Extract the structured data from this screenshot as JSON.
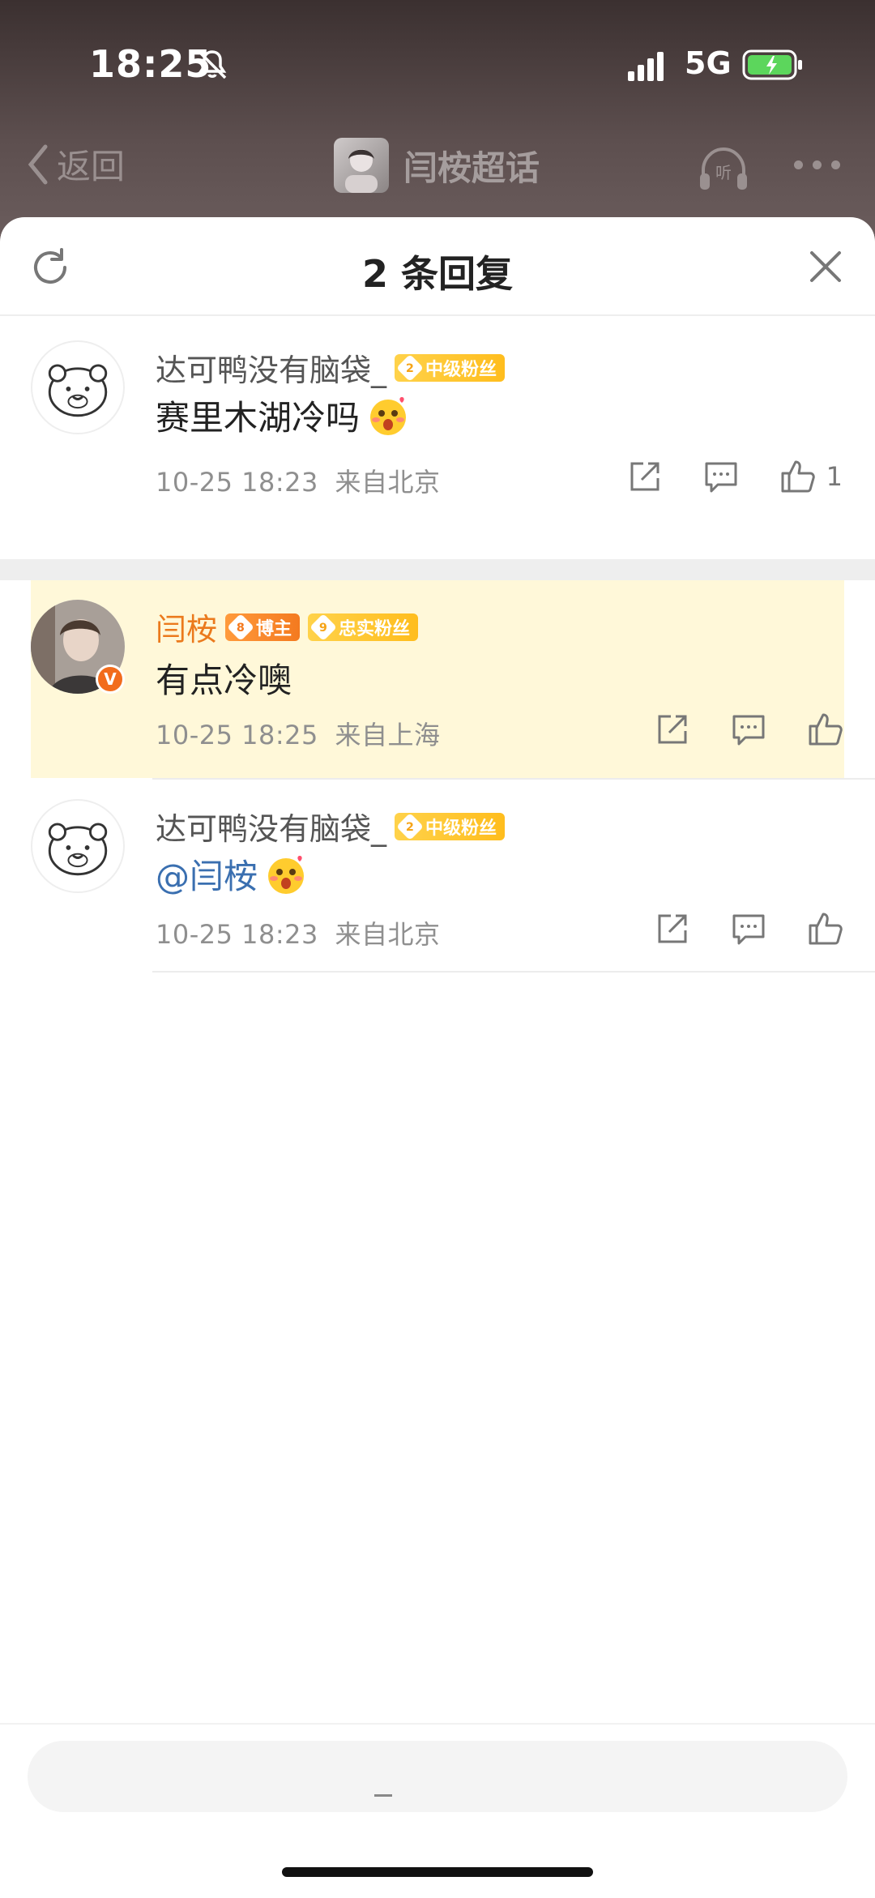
{
  "status_bar": {
    "time": "18:25",
    "network": "5G"
  },
  "header": {
    "back_label": "返回",
    "topic_title": "闫桉超话",
    "listen_label": "听"
  },
  "sheet": {
    "title": "2 条回复"
  },
  "comments": [
    {
      "username": "达可鸭没有脑袋_",
      "fan_level": "2",
      "fan_badge": "中级粉丝",
      "text": "赛里木湖冷吗",
      "time": "10-25 18:23",
      "location": "来自北京",
      "likes": "1"
    },
    {
      "username": "闫桉",
      "host_level": "8",
      "host_badge": "博主",
      "fan_level": "9",
      "fan_badge": "忠实粉丝",
      "verified": "V",
      "text": "有点冷噢",
      "time": "10-25 18:25",
      "location": "来自上海"
    },
    {
      "username": "达可鸭没有脑袋_",
      "fan_level": "2",
      "fan_badge": "中级粉丝",
      "mention": "@闫桉",
      "time": "10-25 18:23",
      "location": "来自北京"
    }
  ],
  "colors": {
    "accent_orange": "#eb7a1d",
    "mention_blue": "#3a6fb0",
    "highlight_bg": "#fff8d9",
    "fan_badge": "#ffbd1d"
  }
}
